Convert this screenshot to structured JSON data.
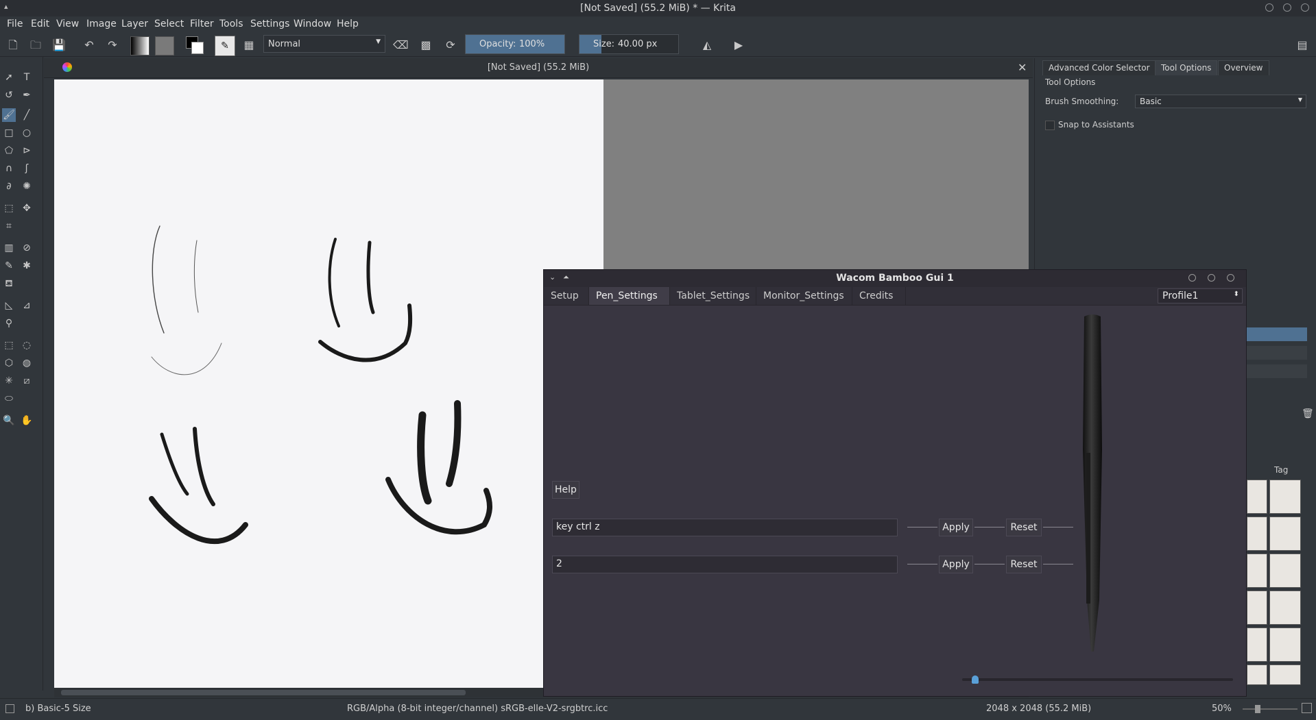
{
  "window": {
    "title": "[Not Saved]  (55.2 MiB) * — Krita"
  },
  "menu": [
    "File",
    "Edit",
    "View",
    "Image",
    "Layer",
    "Select",
    "Filter",
    "Tools",
    "Settings",
    "Window",
    "Help"
  ],
  "toolbar": {
    "blend_mode": "Normal",
    "opacity_label": "Opacity:",
    "opacity_value": "100%",
    "size_label": "Size:",
    "size_value": "40.00 px"
  },
  "document": {
    "title": "[Not Saved]  (55.2 MiB)"
  },
  "docker": {
    "tabs": [
      "Advanced Color Selector",
      "Tool Options",
      "Overview"
    ],
    "active_tab": "Tool Options",
    "section_title": "Tool Options",
    "brush_smoothing_label": "Brush Smoothing:",
    "brush_smoothing_value": "Basic",
    "snap_label": "Snap to Assistants",
    "tag_label": "Tag"
  },
  "dialog": {
    "title": "Wacom Bamboo Gui 1",
    "tabs": [
      "Setup",
      "Pen_Settings",
      "Tablet_Settings",
      "Monitor_Settings",
      "Credits"
    ],
    "active_tab": "Pen_Settings",
    "profile": "Profile1",
    "help_label": "Help",
    "row1_value": "key ctrl z",
    "row2_value": "2",
    "apply_label": "Apply",
    "reset_label": "Reset"
  },
  "status": {
    "brush": "b) Basic-5 Size",
    "color_space": "RGB/Alpha (8-bit integer/channel)  sRGB-elle-V2-srgbtrc.icc",
    "dimensions": "2048 x 2048 (55.2 MiB)",
    "zoom": "50%"
  }
}
